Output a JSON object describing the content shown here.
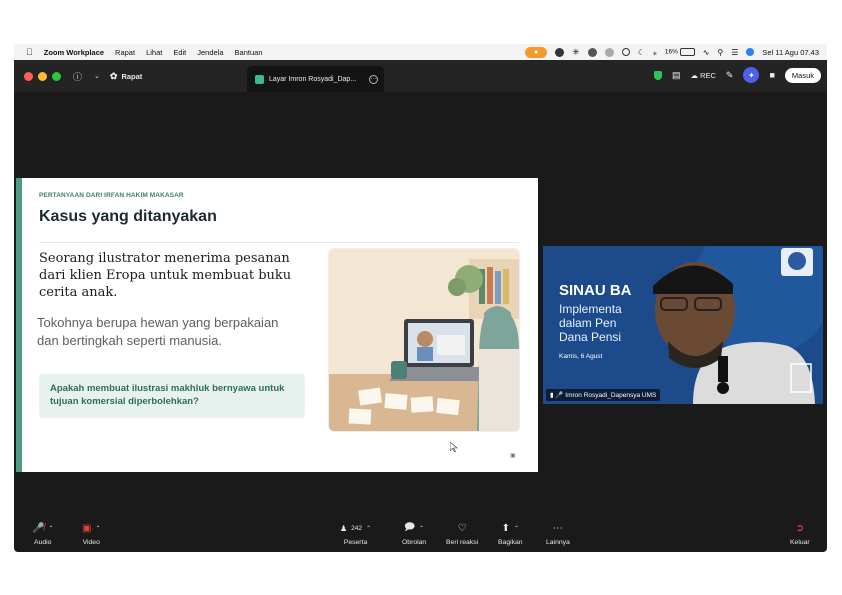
{
  "menubar": {
    "app_name": "Zoom Workplace",
    "menus": [
      "Rapat",
      "Lihat",
      "Edit",
      "Jendela",
      "Bantuan"
    ],
    "battery": "16%",
    "datetime": "Sel 11 Agu  07.43"
  },
  "window": {
    "meeting_label": "Rapat",
    "tab_title": "Layar Imron Rosyadi_Dap...",
    "rec_label": "REC",
    "signin_label": "Masuk"
  },
  "slide": {
    "kicker": "PERTANYAAN DARI IRFAN HAKIM MAKASAR",
    "title": "Kasus yang ditanyakan",
    "lead": "Seorang ilustrator menerima pesanan dari klien Eropa untuk membuat buku cerita anak.",
    "sub": "Tokohnya berupa hewan yang berpakaian dan bertingkah seperti manusia.",
    "question": "Apakah membuat ilustrasi makhluk bernyawa untuk tujuan komersial diperbolehkan?"
  },
  "video": {
    "banner_title": "SINAU BA",
    "banner_lines": [
      "Implementa",
      "dalam Pen",
      "Dana Pensi"
    ],
    "banner_date": "Kamis, 6 Agust",
    "participant_name": "Imron Rosyadi_Dapensya UMS"
  },
  "controls": {
    "audio": "Audio",
    "video": "Video",
    "participants": "Peserta",
    "participant_count": "242",
    "chat": "Obrolan",
    "react": "Beri reaksi",
    "share": "Bagikan",
    "more": "Lainnya",
    "leave": "Keluar"
  },
  "colors": {
    "accent_green": "#4e9a83",
    "window_bg": "#1a1a1a",
    "leave_red": "#e0453a"
  }
}
